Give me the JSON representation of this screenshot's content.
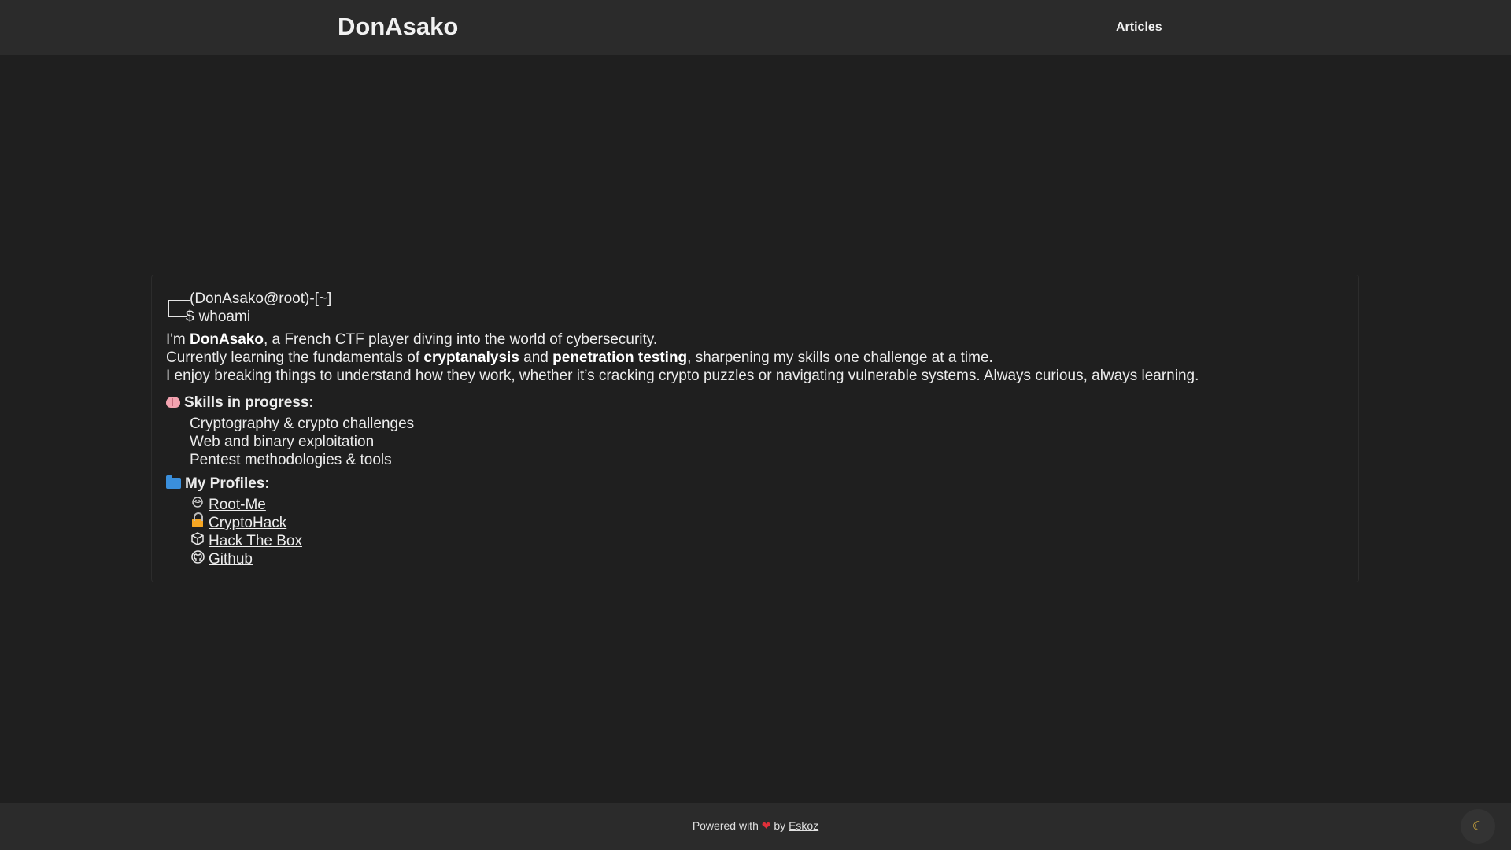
{
  "header": {
    "site_title": "DonAsako",
    "nav": {
      "articles_label": "Articles"
    }
  },
  "terminal": {
    "prompt_line": "(DonAsako@root)-[~]",
    "dollar": "$",
    "command": "whoami"
  },
  "intro": {
    "line1": {
      "prefix": "I'm ",
      "name": "DonAsako",
      "suffix": ", a French CTF player diving into the world of cybersecurity."
    },
    "line2": {
      "prefix": "Currently learning the fundamentals of ",
      "topic1": "cryptanalysis",
      "middle": " and ",
      "topic2": "penetration testing",
      "suffix": ", sharpening my skills one challenge at a time."
    },
    "line3": "I enjoy breaking things to understand how they work, whether it’s cracking crypto puzzles or navigating vulnerable systems. Always curious, always learning."
  },
  "skills": {
    "heading": "Skills in progress:",
    "icon": "brain-icon",
    "items": [
      "Cryptography & crypto challenges",
      "Web and binary exploitation",
      "Pentest methodologies & tools"
    ]
  },
  "profiles": {
    "heading": "My Profiles:",
    "icon": "folder-icon",
    "items": [
      {
        "label": "Root-Me",
        "icon": "hacker-mask-icon"
      },
      {
        "label": "CryptoHack",
        "icon": "lock-icon"
      },
      {
        "label": "Hack The Box",
        "icon": "cube-icon"
      },
      {
        "label": "Github",
        "icon": "github-icon"
      }
    ]
  },
  "footer": {
    "powered_prefix": "Powered with",
    "by": "by",
    "author": "Eskoz"
  },
  "theme_toggle": {
    "icon": "moon-icon"
  },
  "colors": {
    "background": "#1f1f1f",
    "header_bg": "#2b2b2b",
    "text": "#ececec",
    "heart": "#e0303a"
  }
}
